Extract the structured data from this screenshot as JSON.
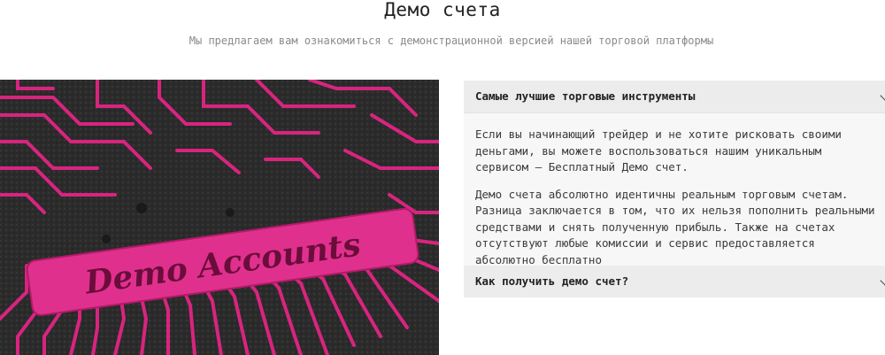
{
  "header": {
    "title": "Демо счета",
    "subtitle": "Мы предлагаем вам ознакомиться с демонстрационной версией нашей торговой платформы"
  },
  "hero_image": {
    "caption": "Demo Accounts",
    "colors": {
      "trace": "#d9247f",
      "board": "#2b2b2b",
      "label": "#e0308e"
    }
  },
  "accordion": {
    "items": [
      {
        "title": "Самые лучшие торговые инструменты",
        "expanded": true,
        "paragraphs": [
          "Если вы начинающий трейдер и не хотите рисковать своими\nденьгами, вы можете воспользоваться нашим уникальным\nсервисом — Бесплатный Демо счет.",
          "Демо счета абсолютно идентичны реальным торговым счетам.\nРазница заключается в том, что их нельзя пополнить реальными\nсредствами и снять полученную прибыль. Также на счетах\nотсутствуют любые комиссии и сервис предоставляется\nабсолютно бесплатно"
        ]
      },
      {
        "title": "Как получить демо счет?",
        "expanded": false
      }
    ],
    "icons": {
      "toggle": "chevron-down-icon"
    }
  }
}
